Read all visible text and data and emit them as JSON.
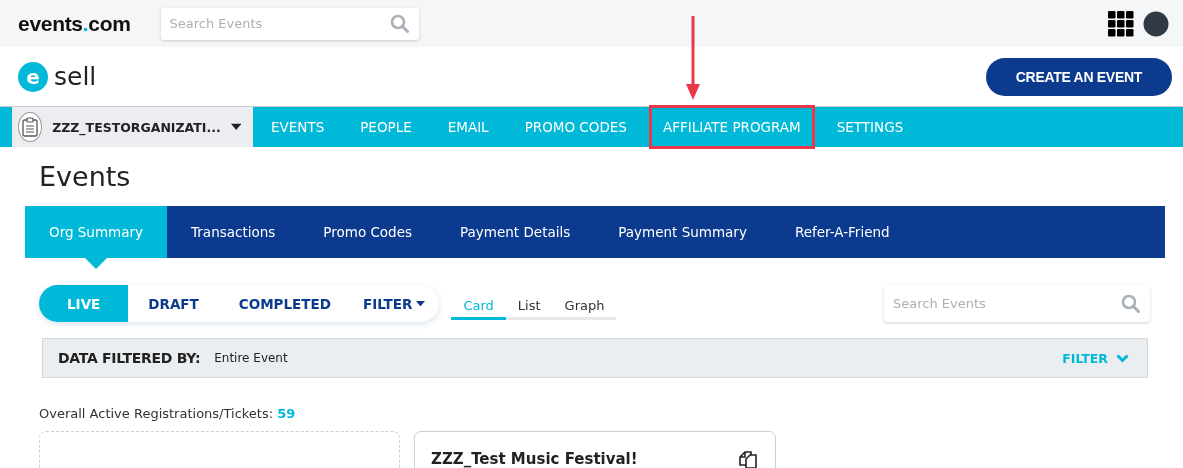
{
  "topbar": {
    "logo_main": "events",
    "logo_dot": ".",
    "logo_tail": "com",
    "search": {
      "placeholder": "Search Events"
    }
  },
  "header": {
    "brand_letter": "e",
    "brand_name": "sell",
    "create_button": "CREATE AN EVENT"
  },
  "nav": {
    "organization": "ZZZ_TESTORGANIZATI...",
    "items": [
      {
        "label": "EVENTS",
        "highlighted": false
      },
      {
        "label": "PEOPLE",
        "highlighted": false
      },
      {
        "label": "EMAIL",
        "highlighted": false
      },
      {
        "label": "PROMO CODES",
        "highlighted": false
      },
      {
        "label": "AFFILIATE PROGRAM",
        "highlighted": true
      },
      {
        "label": "SETTINGS",
        "highlighted": false
      }
    ]
  },
  "page_title": "Events",
  "tabs": [
    {
      "label": "Org Summary",
      "selected": true
    },
    {
      "label": "Transactions",
      "selected": false
    },
    {
      "label": "Promo Codes",
      "selected": false
    },
    {
      "label": "Payment Details",
      "selected": false
    },
    {
      "label": "Payment Summary",
      "selected": false
    },
    {
      "label": "Refer-A-Friend",
      "selected": false
    }
  ],
  "status_filters": [
    {
      "label": "LIVE",
      "selected": true
    },
    {
      "label": "DRAFT",
      "selected": false
    },
    {
      "label": "COMPLETED",
      "selected": false
    }
  ],
  "filter_menu": "FILTER",
  "views": [
    {
      "label": "Card",
      "selected": true
    },
    {
      "label": "List",
      "selected": false
    },
    {
      "label": "Graph",
      "selected": false
    }
  ],
  "event_search": {
    "placeholder": "Search Events"
  },
  "filter_bar": {
    "label": "DATA FILTERED BY:",
    "value": "Entire Event",
    "toggle": "FILTER"
  },
  "registrations": {
    "label": "Overall Active Registrations/Tickets:",
    "count": "59"
  },
  "cards": [
    {
      "kind": "empty"
    },
    {
      "kind": "event",
      "title": "ZZZ_Test Music Festival!"
    }
  ]
}
